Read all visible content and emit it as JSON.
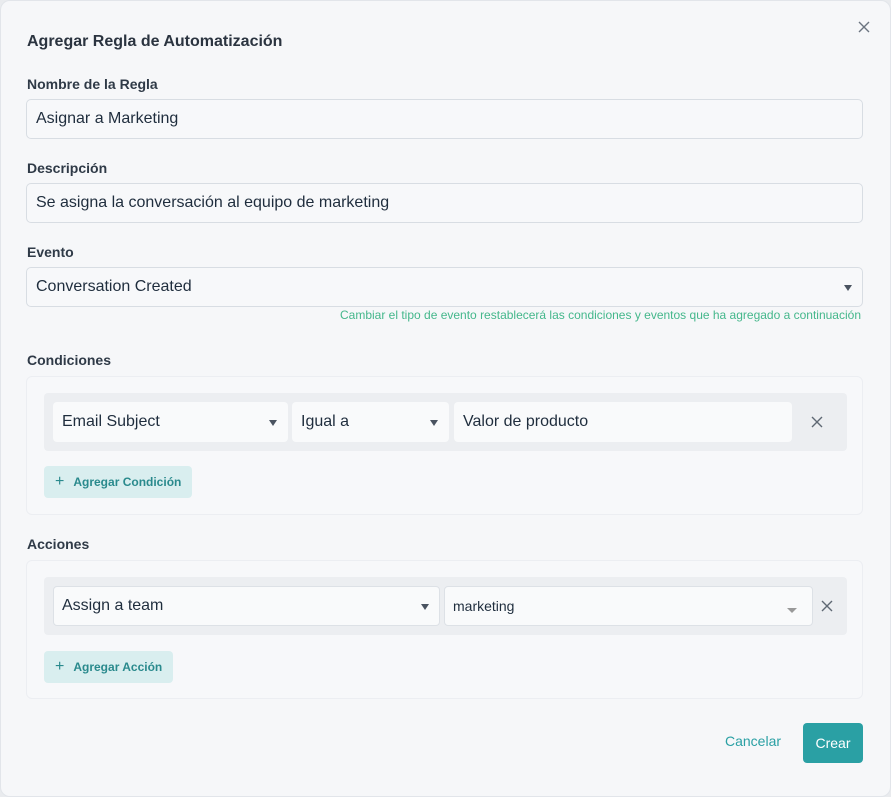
{
  "modal": {
    "title": "Agregar Regla de Automatización",
    "close_icon": "close-icon"
  },
  "rule_name": {
    "label": "Nombre de la Regla",
    "value": "Asignar a Marketing"
  },
  "description": {
    "label": "Descripción",
    "value": "Se asigna la conversación al equipo de marketing"
  },
  "event": {
    "label": "Evento",
    "value": "Conversation Created",
    "hint": "Cambiar el tipo de evento restablecerá las condiciones y eventos que ha agregado a continuación"
  },
  "conditions": {
    "label": "Condiciones",
    "rows": [
      {
        "attribute": "Email Subject",
        "operator": "Igual a",
        "value": "Valor de producto"
      }
    ],
    "add_label": "Agregar Condición"
  },
  "actions": {
    "label": "Acciones",
    "rows": [
      {
        "action": "Assign a team",
        "value": "marketing"
      }
    ],
    "add_label": "Agregar Acción"
  },
  "footer": {
    "cancel_label": "Cancelar",
    "create_label": "Crear"
  },
  "colors": {
    "accent": "#2aa0a4",
    "hint": "#44b78b"
  }
}
